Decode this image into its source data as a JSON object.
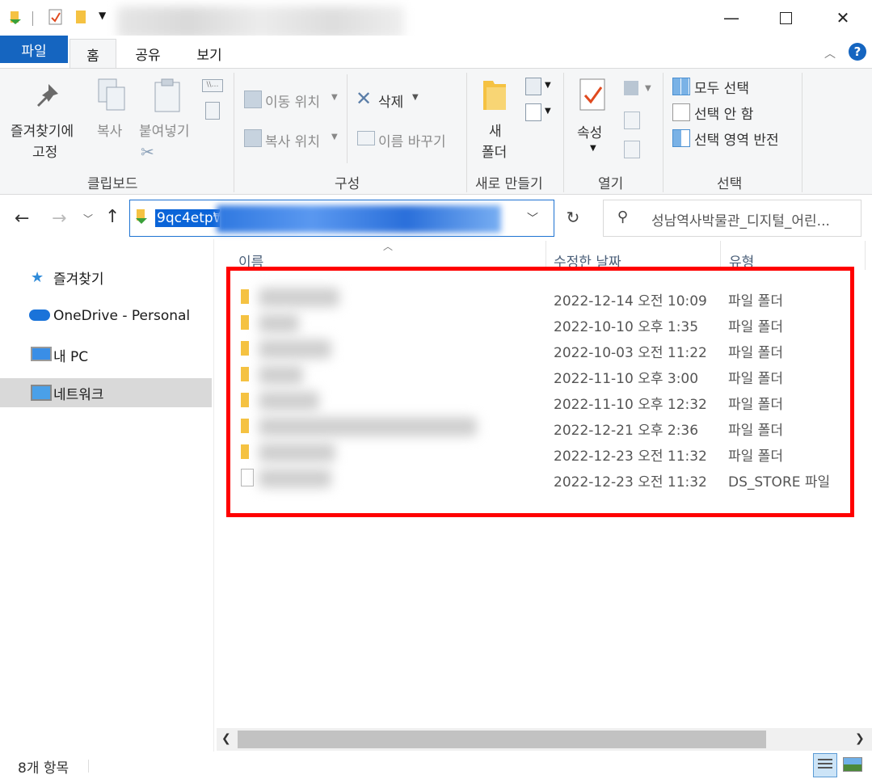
{
  "window": {
    "minimize_icon": "minimize-icon",
    "maximize_icon": "maximize-icon",
    "close_icon": "close-icon"
  },
  "ribbon_tabs": {
    "file": "파일",
    "home": "홈",
    "share": "공유",
    "view": "보기"
  },
  "ribbon": {
    "pin": "즐겨찾기에\n고정",
    "pin_line1": "즐겨찾기에",
    "pin_line2": "고정",
    "copy": "복사",
    "paste": "붙여넣기",
    "move_to": "이동 위치",
    "copy_to": "복사 위치",
    "delete": "삭제",
    "rename": "이름 바꾸기",
    "new_folder_line1": "새",
    "new_folder_line2": "폴더",
    "properties": "속성",
    "select_all": "모두 선택",
    "select_none": "선택 안 함",
    "invert_selection": "선택 영역 반전",
    "groups": {
      "clipboard": "클립보드",
      "organize": "구성",
      "new": "새로 만들기",
      "open": "열기",
      "select": "선택"
    }
  },
  "address": {
    "path_visible": "9qc4etp₩",
    "search_placeholder": "성남역사박물관_디지털_어린..."
  },
  "nav": {
    "items": [
      {
        "label": "즐겨찾기"
      },
      {
        "label": "OneDrive - Personal"
      },
      {
        "label": "내 PC"
      },
      {
        "label": "네트워크"
      }
    ]
  },
  "columns": {
    "name": "이름",
    "modified": "수정한 날짜",
    "type": "유형"
  },
  "files": [
    {
      "date": "2022-12-14 오전 10:09",
      "type": "파일 폴더",
      "icon": "folder-icon"
    },
    {
      "date": "2022-10-10 오후 1:35",
      "type": "파일 폴더",
      "icon": "folder-icon"
    },
    {
      "date": "2022-10-03 오전 11:22",
      "type": "파일 폴더",
      "icon": "folder-icon"
    },
    {
      "date": "2022-11-10 오후 3:00",
      "type": "파일 폴더",
      "icon": "folder-icon"
    },
    {
      "date": "2022-11-10 오후 12:32",
      "type": "파일 폴더",
      "icon": "folder-icon"
    },
    {
      "date": "2022-12-21 오후 2:36",
      "type": "파일 폴더",
      "icon": "folder-icon"
    },
    {
      "date": "2022-12-23 오전 11:32",
      "type": "파일 폴더",
      "icon": "folder-icon"
    },
    {
      "date": "2022-12-23 오전 11:32",
      "type": "DS_STORE 파일",
      "icon": "file-icon"
    }
  ],
  "status": {
    "count": "8개 항목"
  },
  "colors": {
    "accent": "#1565c0",
    "highlight": "#ff0000",
    "folder": "#f5c242"
  }
}
